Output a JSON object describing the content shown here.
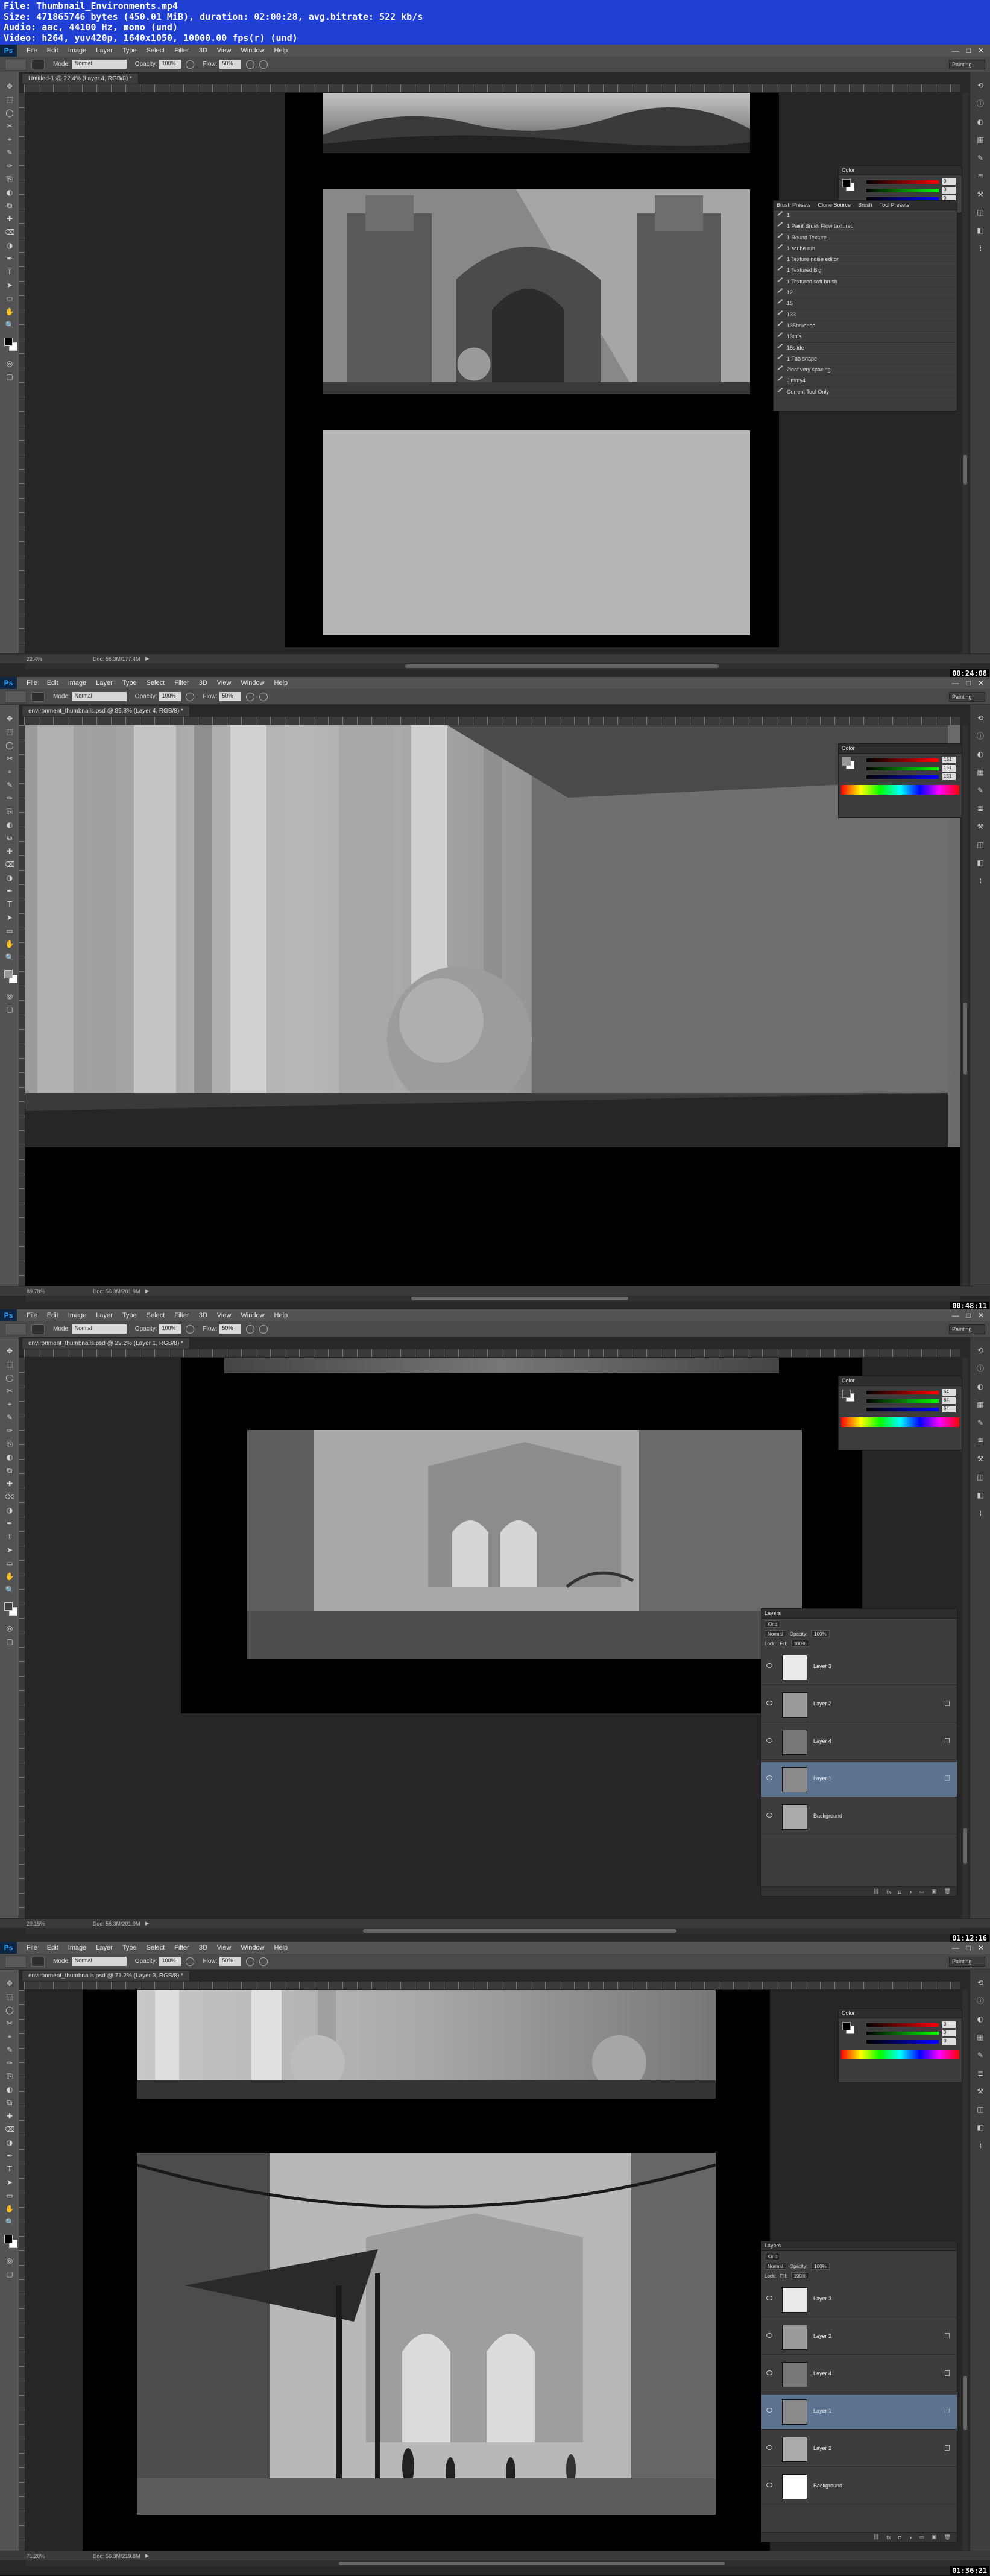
{
  "video_info": {
    "line1": "File: Thumbnail_Environments.mp4",
    "line2": "Size: 471865746 bytes (450.01 MiB), duration: 02:00:28, avg.bitrate: 522 kb/s",
    "line3": "Audio: aac, 44100 Hz, mono (und)",
    "line4": "Video: h264, yuv420p, 1640x1050, 10000.00 fps(r) (und)"
  },
  "menu": {
    "logo": "Ps",
    "items": [
      "File",
      "Edit",
      "Image",
      "Layer",
      "Type",
      "Select",
      "Filter",
      "3D",
      "View",
      "Window",
      "Help"
    ]
  },
  "options": {
    "mode_label": "Mode:",
    "mode_value": "Normal",
    "opacity_label": "Opacity:",
    "opacity_value": "100%",
    "flow_label": "Flow:",
    "flow_value": "50%",
    "workspace": "Painting"
  },
  "panels": {
    "color_title": "Color",
    "layers_title": "Layers",
    "tool_presets_tabs": [
      "Brush Presets",
      "Clone Source",
      "Brush",
      "Tool Presets"
    ],
    "tool_presets": [
      "1",
      "1 Paint Brush Flow textured",
      "1 Round Texture",
      "1 scribe ruh",
      "1 Texture noise editor",
      "1 Textured Big",
      "1 Textured soft brush",
      "12",
      "15",
      "133",
      "135brushes",
      "13this",
      "15slide",
      "1 Fab shape",
      "2leaf very spacing",
      "Jimmy4",
      "Current Tool Only"
    ],
    "layer_kind": "Kind",
    "layer_blend": "Normal",
    "layer_opacity_label": "Opacity:",
    "layer_opacity_value": "100%",
    "layer_lock_label": "Lock:",
    "layer_fill_label": "Fill:",
    "layer_fill_value": "100%"
  },
  "shots": [
    {
      "doc_tab": "Untitled-1 @ 22.4% (Layer 4, RGB/8) *",
      "zoom": "22.4%",
      "doc_size": "Doc: 56.3M/177.4M",
      "timestamp": "00:24:08",
      "color_values": [
        "0",
        "0",
        "0"
      ],
      "layers": []
    },
    {
      "doc_tab": "environment_thumbnails.psd @ 89.8% (Layer 4, RGB/8) *",
      "zoom": "89.78%",
      "doc_size": "Doc: 56.3M/201.9M",
      "timestamp": "00:48:11",
      "color_values": [
        "151",
        "151",
        "151"
      ],
      "layers": []
    },
    {
      "doc_tab": "environment_thumbnails.psd @ 29.2% (Layer 1, RGB/8) *",
      "zoom": "29.15%",
      "doc_size": "Doc: 56.3M/201.9M",
      "timestamp": "01:12:16",
      "color_values": [
        "64",
        "64",
        "64"
      ],
      "layers": [
        "Layer 3",
        "Layer 2",
        "Layer 4",
        "Layer 1",
        "Background"
      ]
    },
    {
      "doc_tab": "environment_thumbnails.psd @ 71.2% (Layer 3, RGB/8) *",
      "zoom": "71.20%",
      "doc_size": "Doc: 56.3M/219.8M",
      "timestamp": "01:36:21",
      "color_values": [
        "0",
        "0",
        "0"
      ],
      "layers": [
        "Layer 3",
        "Layer 2",
        "Layer 4",
        "Layer 1",
        "Layer 2",
        "Background"
      ]
    }
  ]
}
